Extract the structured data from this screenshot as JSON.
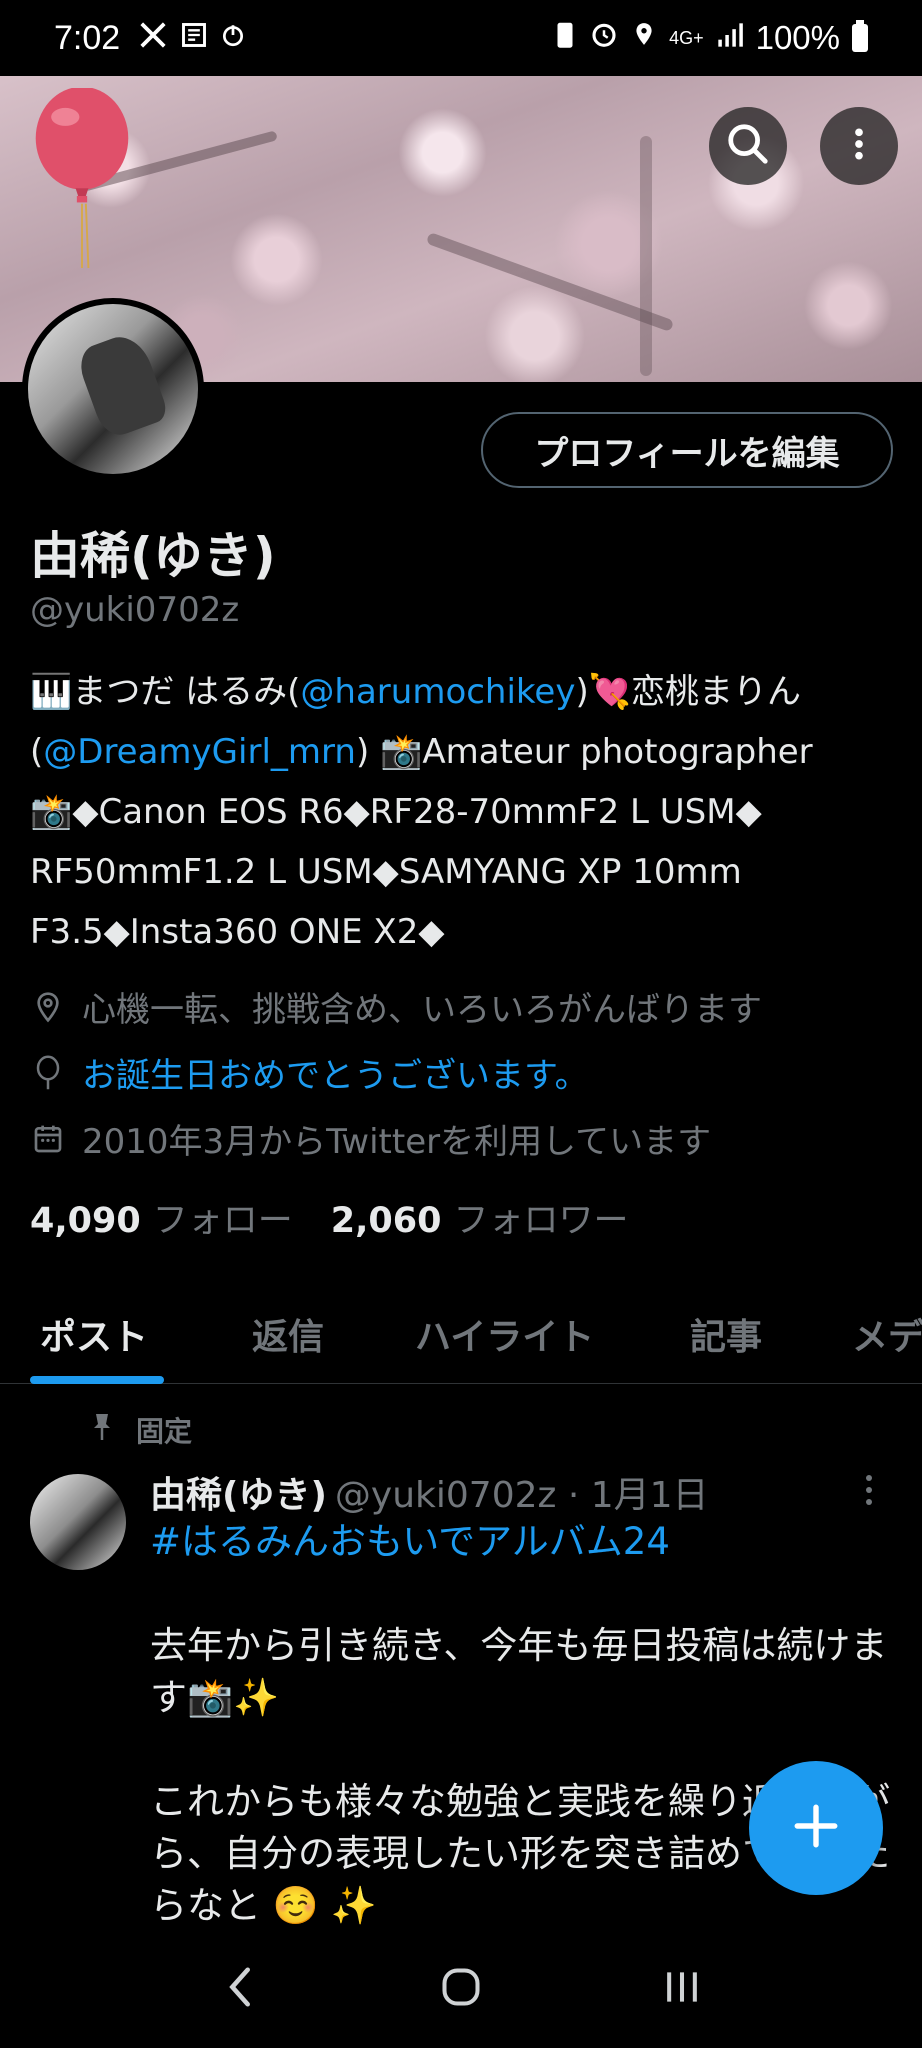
{
  "status_bar": {
    "time": "7:02",
    "network": "4G+",
    "battery": "100%"
  },
  "profile": {
    "edit_label": "プロフィールを編集",
    "name": "由稀(ゆき)",
    "handle": "@yuki0702z",
    "bio": {
      "line1_pre": "🎹まつだ はるみ(",
      "line1_link": "@harumochikey",
      "line1_post": ")💘恋桃まりん",
      "line2_pre": "(",
      "line2_link": "@DreamyGirl_mrn",
      "line2_post": ") 📸Amateur photographer",
      "line3": "📸◆Canon EOS R6◆RF28-70mmF2 L USM◆",
      "line4": "RF50mmF1.2 L USM◆SAMYANG XP 10mm",
      "line5": "F3.5◆Insta360 ONE X2◆"
    },
    "location": "心機一転、挑戦含め、いろいろがんばります",
    "birthday": "お誕生日おめでとうございます。",
    "joined": "2010年3月からTwitterを利用しています",
    "following_count": "4,090",
    "following_label": "フォロー",
    "followers_count": "2,060",
    "followers_label": "フォロワー"
  },
  "tabs": [
    {
      "label": "ポスト",
      "active": true
    },
    {
      "label": "返信"
    },
    {
      "label": "ハイライト"
    },
    {
      "label": "記事"
    },
    {
      "label": "メデ"
    }
  ],
  "pinned_post": {
    "pinned_label": "固定",
    "author_name": "由稀(ゆき)",
    "author_meta": "@yuki0702z · 1月1日",
    "hashtag": "#はるみんおもいでアルバム24",
    "para1": "去年から引き続き、今年も毎日投稿は続けます📸✨",
    "para2": "これからも様々な勉強と実践を繰り返しながら、自分の表現したい形を突き詰めていけたらなと ☺️ ✨"
  },
  "colors": {
    "accent": "#1d9bf0",
    "text_primary": "#e7e9ea",
    "text_secondary": "#71767b",
    "background": "#000000"
  },
  "icons": [
    "x-icon",
    "news-icon",
    "power-icon",
    "search-icon",
    "more-vertical-icon",
    "location-icon",
    "balloon-icon",
    "calendar-icon",
    "pin-icon",
    "compose-plus-icon",
    "back-icon",
    "home-icon",
    "recents-icon"
  ]
}
